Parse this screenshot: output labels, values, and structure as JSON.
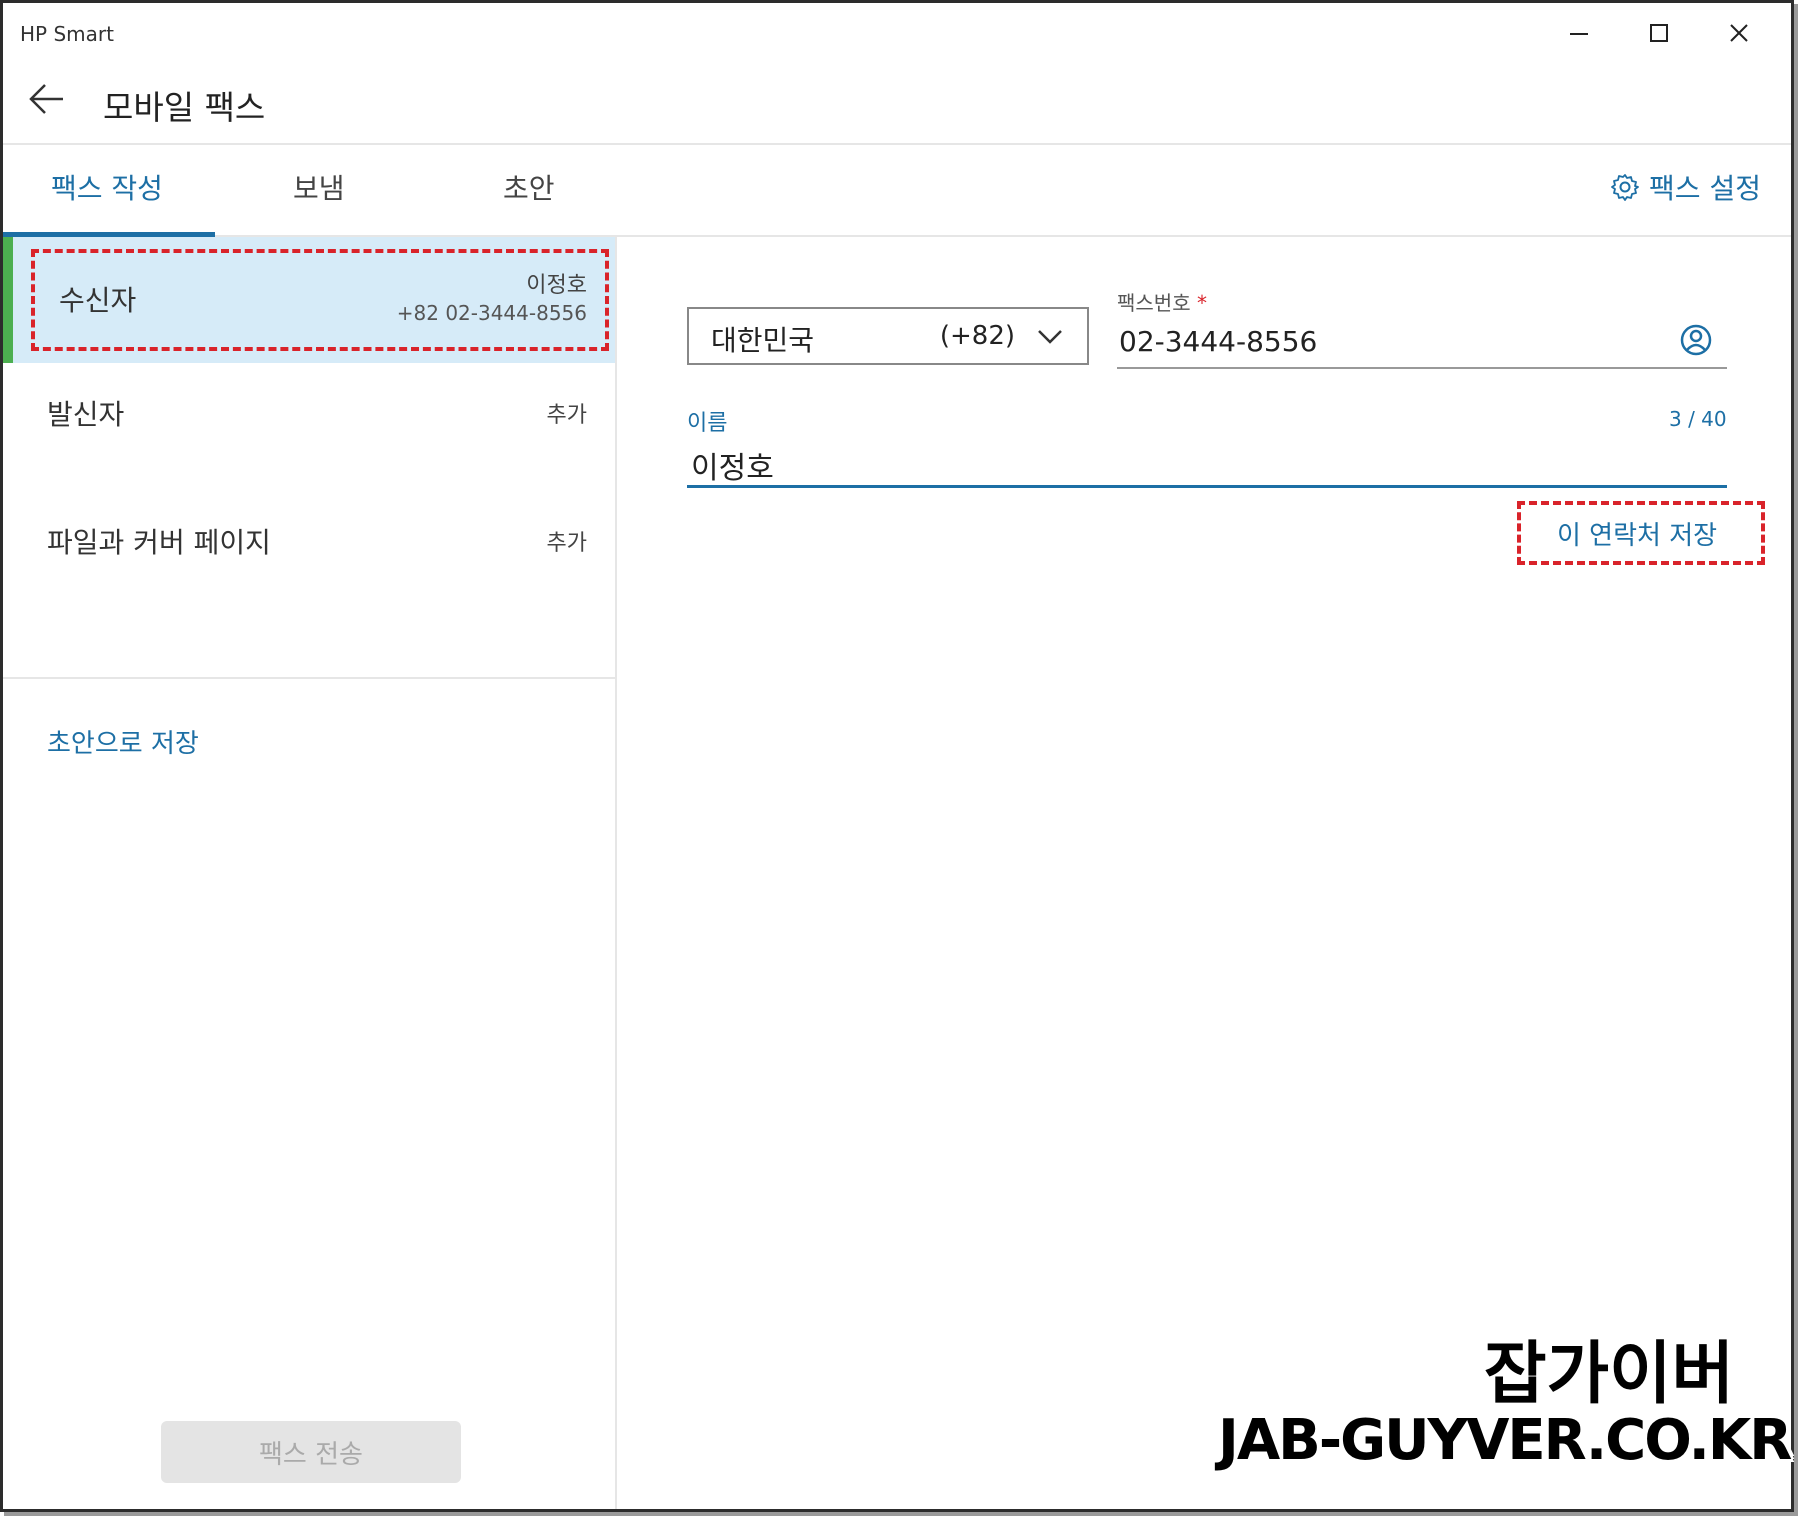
{
  "window": {
    "title": "HP Smart"
  },
  "header": {
    "title": "모바일 팩스"
  },
  "tabs": [
    {
      "label": "팩스 작성",
      "active": true
    },
    {
      "label": "보냄",
      "active": false
    },
    {
      "label": "초안",
      "active": false
    }
  ],
  "settings": {
    "label": "팩스 설정",
    "icon": "gear-icon"
  },
  "left_panel": {
    "recipient": {
      "label": "수신자",
      "name": "이정호",
      "number": "+82 02-3444-8556"
    },
    "sender": {
      "label": "발신자",
      "action": "추가"
    },
    "files": {
      "label": "파일과 커버 페이지",
      "action": "추가"
    },
    "save_draft": "초안으로 저장",
    "send_button": "팩스 전송"
  },
  "form": {
    "country": {
      "name": "대한민국",
      "code": "(+82)"
    },
    "fax_number": {
      "label": "팩스번호",
      "required_mark": "*",
      "value": "02-3444-8556"
    },
    "name": {
      "label": "이름",
      "value": "이정호",
      "count": "3 / 40"
    },
    "save_contact": "이 연락처 저장"
  },
  "watermark": {
    "ko": "잡가이버",
    "en": "JAB-GUYVER.CO.KR"
  },
  "colors": {
    "accent": "#1d6fa5",
    "selected_row": "#d6ebf8",
    "green_bar": "#4caf50",
    "annotation_red": "#d9232a"
  }
}
